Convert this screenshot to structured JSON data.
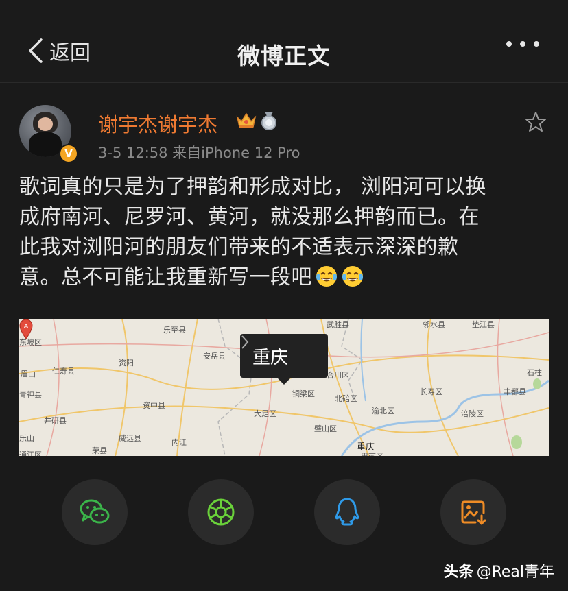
{
  "header": {
    "back_label": "返回",
    "title": "微博正文"
  },
  "post": {
    "username": "谢宇杰谢宇杰",
    "verified_badge": "V",
    "meta": "3-5 12:58  来自iPhone 12 Pro",
    "text_lines": [
      "歌词真的只是为了押韵和形成对比， 浏阳河可以换",
      "成府南河、尼罗河、黄河，就没那么押韵而已。在",
      "此我对浏阳河的朋友们带来的不适表示深深的歉",
      "意。总不可能让我重新写一段吧"
    ],
    "emojis": [
      "laugh-cry-emoji",
      "laugh-cry-emoji"
    ]
  },
  "map": {
    "bubble_label": "重庆",
    "pin_letter": "A",
    "place_labels": [
      "乐至县",
      "安岳县",
      "资阳",
      "仁寿县",
      "眉山",
      "青神县",
      "资中县",
      "井研县",
      "威远县",
      "内江",
      "荣县",
      "大足区",
      "铜梁区",
      "璧山区",
      "北碚区",
      "合川区",
      "渝北区",
      "长寿区",
      "涪陵区",
      "丰都县",
      "垫江县",
      "邻水县",
      "石柱",
      "武胜县",
      "重庆",
      "巴南区",
      "东坡区",
      "通江区",
      "乐山"
    ]
  },
  "share": {
    "buttons": [
      {
        "name": "wechat",
        "icon": "wechat-icon",
        "color": "#3bb54a"
      },
      {
        "name": "moments",
        "icon": "moments-icon",
        "color": "#6ad13a"
      },
      {
        "name": "qq",
        "icon": "qq-icon",
        "color": "#2f9ae8"
      },
      {
        "name": "save-image",
        "icon": "save-image-icon",
        "color": "#ef8c26"
      }
    ]
  },
  "watermark": {
    "brand": "头条",
    "handle": "@Real青年"
  },
  "colors": {
    "username": "#ef7a32",
    "background": "#1a1a1a",
    "map_bg": "#ece8df"
  }
}
